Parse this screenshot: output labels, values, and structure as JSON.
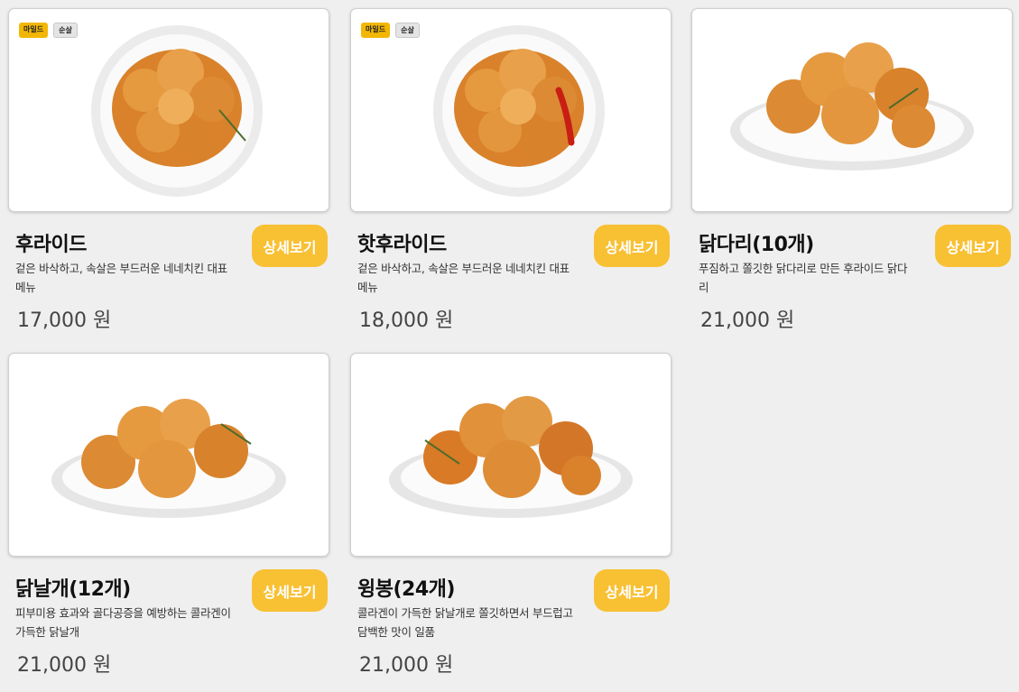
{
  "badges": {
    "mild": "마일드",
    "boneless": "순살"
  },
  "detail_label": "상세보기",
  "colors": {
    "button": "#f8c033",
    "badge_mild": "#f2b705",
    "background": "#efefef"
  },
  "menu": [
    {
      "name": "후라이드",
      "desc": "겉은 바삭하고, 속살은 부드러운 네네치킨 대표메뉴",
      "price": "17,000 원",
      "image": "fried-chicken-round-plate"
    },
    {
      "name": "핫후라이드",
      "desc": "겉은 바삭하고, 속살은 부드러운 네네치킨 대표메뉴",
      "price": "18,000 원",
      "image": "hot-fried-chicken-with-chili"
    },
    {
      "name": "닭다리(10개)",
      "desc": "푸짐하고 쫄깃한 닭다리로 만든 후라이드 닭다리",
      "price": "21,000 원",
      "image": "fried-drumsticks-oval-plate"
    },
    {
      "name": "닭날개(12개)",
      "desc": "피부미용 효과와 골다공증을 예방하는 콜라겐이 가득한 닭날개",
      "price": "21,000 원",
      "image": "fried-wings-oval-plate"
    },
    {
      "name": "윙봉(24개)",
      "desc": "콜라겐이 가득한 닭날개로 쫄깃하면서 부드럽고 담백한 맛이 일품",
      "price": "21,000 원",
      "image": "fried-wingbong-oval-plate"
    }
  ]
}
